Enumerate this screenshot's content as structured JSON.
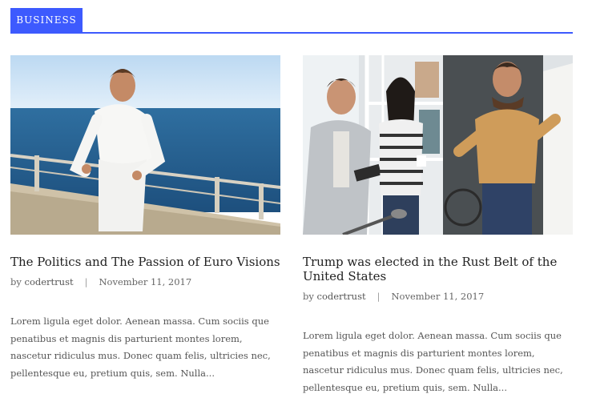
{
  "section": {
    "tag": "BUSINESS",
    "accent": "#3d5afe"
  },
  "posts": [
    {
      "title": "The Politics and The Passion of Euro Visions",
      "by": "by",
      "author": "codertrust",
      "date": "November 11, 2017",
      "excerpt": "Lorem ligula eget dolor. Aenean massa. Cum sociis que penatibus et magnis dis parturient montes lorem, nascetur ridiculus mus. Donec quam felis, ultricies nec, pellentesque eu, pretium quis, sem. Nulla...",
      "image": "man-by-sea-photo"
    },
    {
      "title": "Trump was elected in the Rust Belt of the United States",
      "by": "by",
      "author": "codertrust",
      "date": "November 11, 2017",
      "excerpt": "Lorem ligula eget dolor. Aenean massa. Cum sociis que penatibus et magnis dis parturient montes lorem, nascetur ridiculus mus. Donec quam felis, ultricies nec, pellentesque eu, pretium quis, sem. Nulla...",
      "image": "office-team-photo"
    }
  ]
}
